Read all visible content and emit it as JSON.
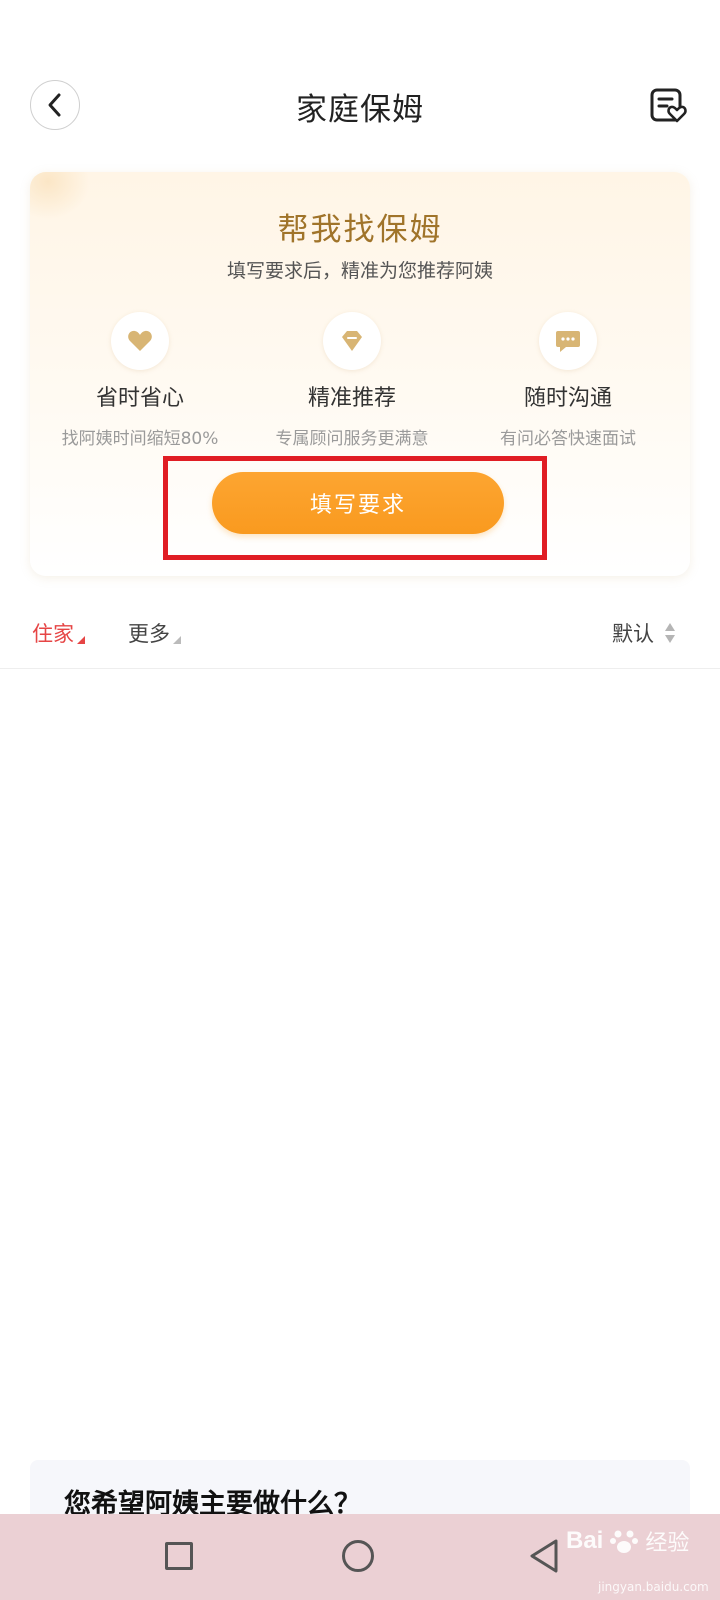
{
  "header": {
    "title": "家庭保姆",
    "back_icon": "chevron-left-icon",
    "right_icon": "favorites-list-icon"
  },
  "promo": {
    "title": "帮我找保姆",
    "subtitle": "填写要求后，精准为您推荐阿姨",
    "features": [
      {
        "icon": "heart-icon",
        "title": "省时省心",
        "desc": "找阿姨时间缩短80%"
      },
      {
        "icon": "diamond-icon",
        "title": "精准推荐",
        "desc": "专属顾问服务更满意"
      },
      {
        "icon": "chat-bubble-icon",
        "title": "随时沟通",
        "desc": "有问必答快速面试"
      }
    ],
    "button_label": "填写要求"
  },
  "filters": {
    "home_label": "住家",
    "more_label": "更多",
    "sort_label": "默认"
  },
  "question": {
    "text": "您希望阿姨主要做什么？"
  },
  "watermark": {
    "brand": "Bai",
    "brand_suffix": "经验",
    "url": "jingyan.baidu.com"
  },
  "colors": {
    "accent_orange": "#f99a1f",
    "title_gold": "#a0742a",
    "active_filter_red": "#e64545",
    "highlight_red": "#e01d24",
    "nav_bar_bg": "#ebd0d4"
  }
}
